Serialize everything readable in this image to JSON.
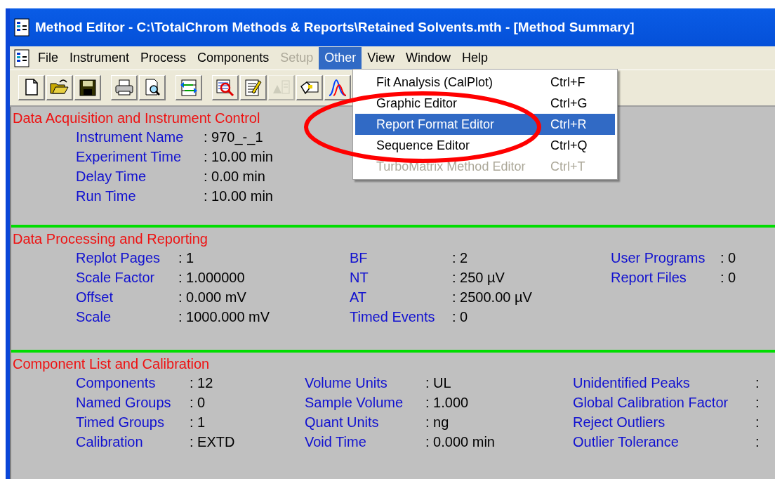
{
  "window": {
    "title": "Method Editor - C:\\TotalChrom Methods & Reports\\Retained Solvents.mth - [Method Summary]"
  },
  "menu_bar": [
    {
      "label": "File",
      "selected": false,
      "disabled": false
    },
    {
      "label": "Instrument",
      "selected": false,
      "disabled": false
    },
    {
      "label": "Process",
      "selected": false,
      "disabled": false
    },
    {
      "label": "Components",
      "selected": false,
      "disabled": false
    },
    {
      "label": "Setup",
      "selected": false,
      "disabled": true
    },
    {
      "label": "Other",
      "selected": true,
      "disabled": false
    },
    {
      "label": "View",
      "selected": false,
      "disabled": false
    },
    {
      "label": "Window",
      "selected": false,
      "disabled": false
    },
    {
      "label": "Help",
      "selected": false,
      "disabled": false
    }
  ],
  "toolbar": [
    {
      "kind": "new",
      "disabled": false
    },
    {
      "kind": "open",
      "disabled": false
    },
    {
      "kind": "save",
      "disabled": false
    },
    {
      "kind": "print",
      "disabled": false
    },
    {
      "kind": "preview",
      "disabled": false
    },
    {
      "kind": "transfer",
      "disabled": false
    },
    {
      "kind": "inspect",
      "disabled": false
    },
    {
      "kind": "edit",
      "disabled": false
    },
    {
      "kind": "peak",
      "disabled": true
    },
    {
      "kind": "tool",
      "disabled": false
    },
    {
      "kind": "chart",
      "disabled": false
    }
  ],
  "dropdown": [
    {
      "label": "Fit Analysis (CalPlot)",
      "shortcut": "Ctrl+F",
      "selected": false,
      "disabled": false
    },
    {
      "label": "Graphic Editor",
      "shortcut": "Ctrl+G",
      "selected": false,
      "disabled": false
    },
    {
      "label": "Report Format Editor",
      "shortcut": "Ctrl+R",
      "selected": true,
      "disabled": false
    },
    {
      "label": "Sequence Editor",
      "shortcut": "Ctrl+Q",
      "selected": false,
      "disabled": false
    },
    {
      "label": "TurboMatrix Method Editor",
      "shortcut": "Ctrl+T",
      "selected": false,
      "disabled": true
    }
  ],
  "sections": [
    {
      "title": "Data Acquisition and Instrument Control",
      "columns": [
        {
          "fields": [
            {
              "label": "Instrument Name",
              "value": ": 970_-_1"
            },
            {
              "label": "Experiment Time",
              "value": ": 10.00 min"
            },
            {
              "label": "Delay Time",
              "value": ": 0.00 min"
            },
            {
              "label": "Run Time",
              "value": ": 10.00 min"
            }
          ]
        }
      ]
    },
    {
      "title": "Data Processing and Reporting",
      "columns": [
        {
          "fields": [
            {
              "label": "Replot Pages",
              "value": ": 1"
            },
            {
              "label": "Scale Factor",
              "value": ": 1.000000"
            },
            {
              "label": "Offset",
              "value": ": 0.000 mV"
            },
            {
              "label": "Scale",
              "value": ": 1000.000 mV"
            }
          ]
        },
        {
          "fields": [
            {
              "label": "BF",
              "value": ": 2"
            },
            {
              "label": "NT",
              "value": ": 250 µV"
            },
            {
              "label": "AT",
              "value": ": 2500.00 µV"
            },
            {
              "label": "Timed Events",
              "value": ": 0"
            }
          ]
        },
        {
          "fields": [
            {
              "label": "User Programs",
              "value": ": 0"
            },
            {
              "label": "Report Files",
              "value": ": 0"
            }
          ]
        }
      ]
    },
    {
      "title": "Component List and Calibration",
      "columns": [
        {
          "fields": [
            {
              "label": "Components",
              "value": ": 12"
            },
            {
              "label": "Named Groups",
              "value": ": 0"
            },
            {
              "label": "Timed Groups",
              "value": ": 1"
            },
            {
              "label": "Calibration",
              "value": ": EXTD"
            }
          ]
        },
        {
          "fields": [
            {
              "label": "Volume Units",
              "value": ": UL"
            },
            {
              "label": "Sample Volume",
              "value": ": 1.000"
            },
            {
              "label": "Quant Units",
              "value": ": ng"
            },
            {
              "label": "Void Time",
              "value": ": 0.000 min"
            }
          ]
        },
        {
          "fields": [
            {
              "label": "Unidentified Peaks",
              "value": ":"
            },
            {
              "label": "Global Calibration Factor",
              "value": ":"
            },
            {
              "label": "Reject Outliers",
              "value": ":"
            },
            {
              "label": "Outlier Tolerance",
              "value": ":"
            }
          ]
        }
      ]
    }
  ]
}
